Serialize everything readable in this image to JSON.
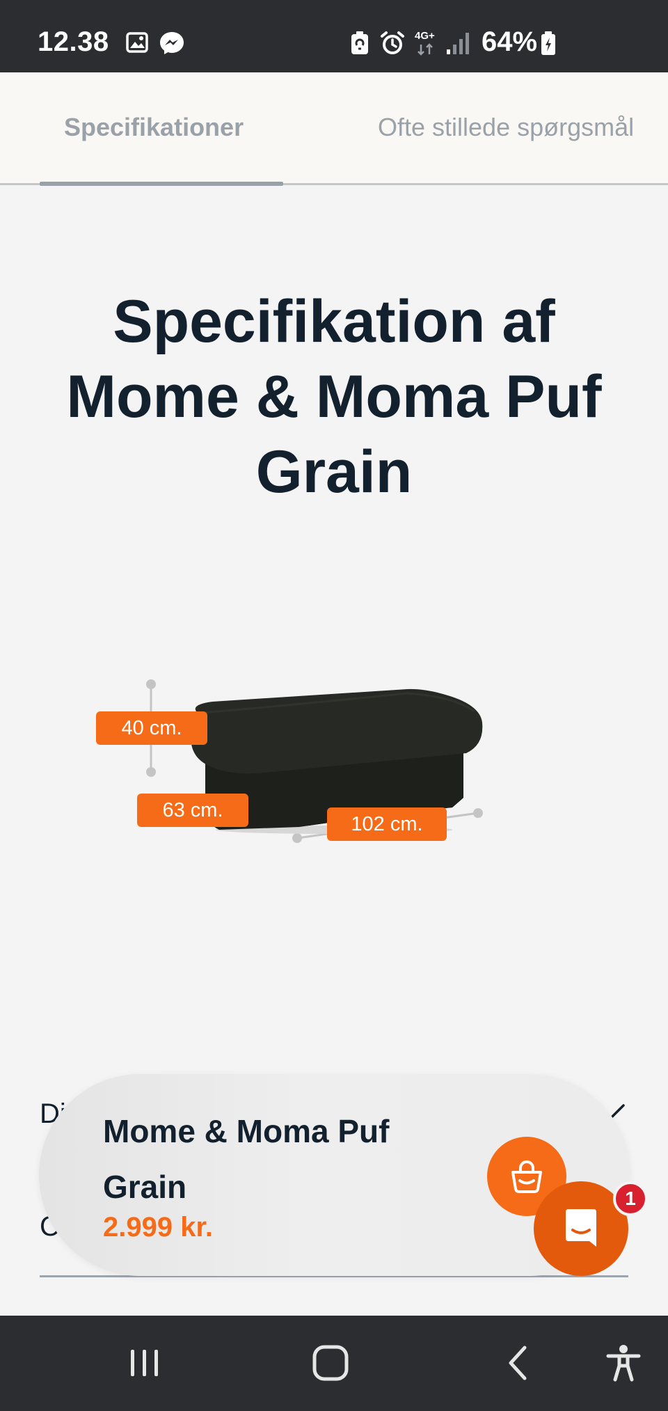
{
  "status_bar": {
    "time": "12.38",
    "network": "4G+",
    "battery": "64%"
  },
  "tabs": [
    {
      "label": "Specifikationer",
      "active": true
    },
    {
      "label": "Ofte stillede spørgsmål",
      "active": false
    }
  ],
  "page_title": "Specifikation af Mome & Moma Puf Grain",
  "dimensions": {
    "height": "40 cm.",
    "depth": "63 cm.",
    "width": "102 cm."
  },
  "accordion": {
    "row1_letter": "Di",
    "row2_letter": "C"
  },
  "sticky_bar": {
    "product_name": "Mome & Moma Puf Grain",
    "price": "2.999 kr."
  },
  "chat": {
    "badge_count": "1"
  },
  "colors": {
    "accent": "#f56b17",
    "title": "#13212e",
    "badge": "#d9202f",
    "product": "#232520"
  },
  "icons": [
    "image-icon",
    "messenger-icon",
    "battery-saver-icon",
    "alarm-icon",
    "signal-icon",
    "battery-icon",
    "cart-bag-icon",
    "chat-icon",
    "recent-apps-icon",
    "home-icon",
    "back-icon",
    "accessibility-icon"
  ]
}
